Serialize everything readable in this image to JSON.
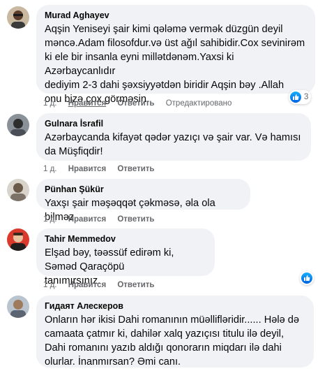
{
  "actions": {
    "time": "1 д.",
    "like": "Нравится",
    "reply": "Ответить",
    "edited": "Отредактировано"
  },
  "comments": [
    {
      "author": "Murad Aghayev",
      "text": "Aqşin Yeniseyi şair kimi qələmə vermək düzgün deyil\nməncə.Adam filosofdur.və üst ağıl sahibidir.Cox sevinirəm\nki ele bir insanla eyni millətdənəm.Yaxsi ki Azərbaycanlıdır\ndediyim 2-3 dahi şəxsiyyətdən biridir Aqşin bəy .Allah\nonu bizə çox görməsin.",
      "reactions": "3"
    },
    {
      "author": "Gulnara İsrafil",
      "text": "Azərbaycanda kifayət qədər yazıçı və şair var. Və hamısı\nda Müşfiqdir!"
    },
    {
      "author": "Pünhan Şükür",
      "text": "Yaxşı şair məşəqqət çəkməsə, əla ola bilməz"
    },
    {
      "author": "Tahir Memmedov",
      "text": "Elşad bəy, təəssüf edirəm ki, Səməd Qaraçöpü\ntanımırsınız."
    },
    {
      "author": "Гидаят Алескеров",
      "text": "Onların hər ikisi Dahi romanının müəllifləridir...... Hələ də\ncamaata çatmır ki, dahilər xalq yazıçısı titulu ilə deyil,\nDahi romanını yazıb aldığı qonorarın miqdarı ilə dahi\nolurlar. İnanmırsan? Əmi canı."
    }
  ],
  "colors": {
    "bubble": "#f0f2f5",
    "meta": "#65676b",
    "like_blue": "#0866ff"
  },
  "icons": [
    "like-icon"
  ]
}
